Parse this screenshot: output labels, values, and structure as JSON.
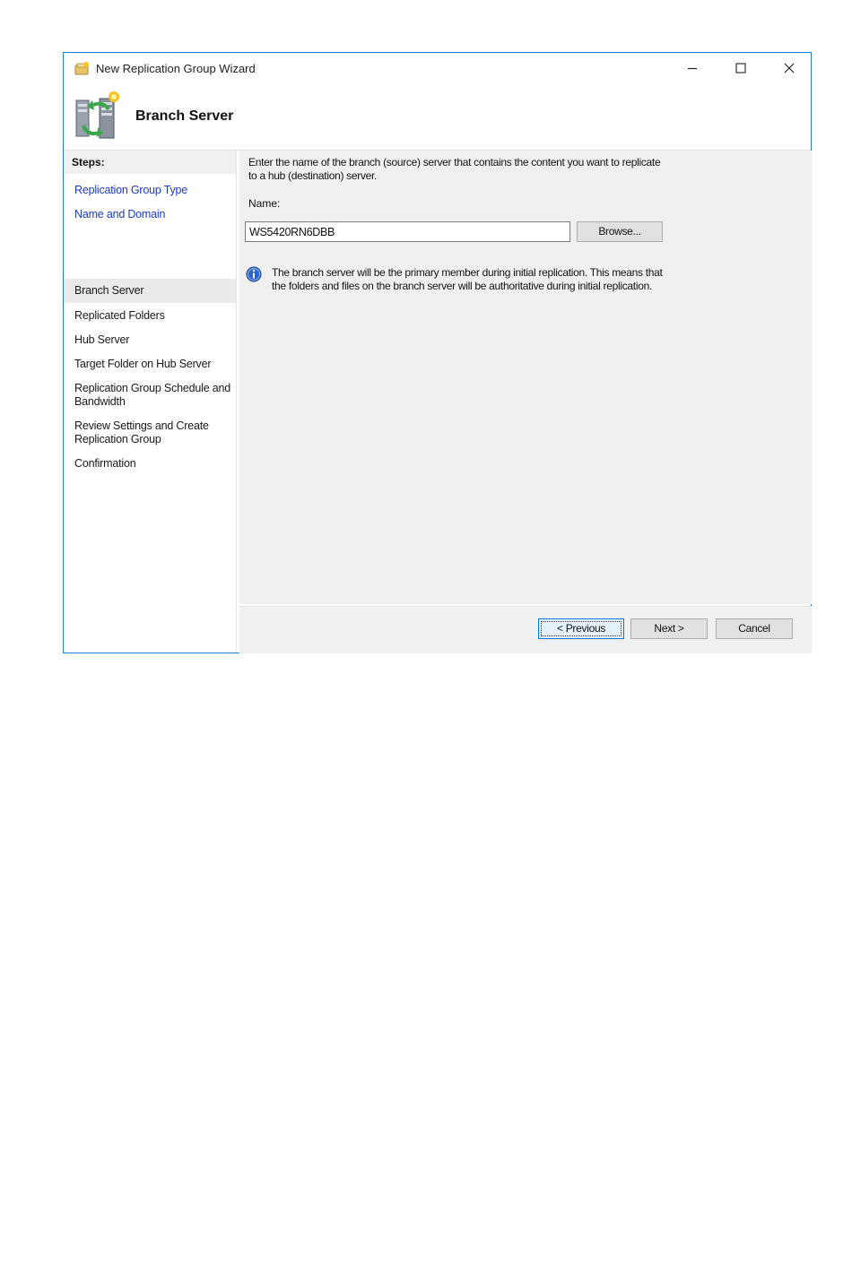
{
  "window": {
    "title": "New Replication Group Wizard",
    "controls": {
      "minimize_icon": "minimize-icon",
      "maximize_icon": "maximize-icon",
      "close_icon": "close-icon"
    }
  },
  "header": {
    "title": "Branch Server",
    "icon": "replication-server-icon"
  },
  "steps": {
    "heading": "Steps:",
    "items": [
      {
        "label": "Replication Group Type",
        "state": "link"
      },
      {
        "label": "Name and Domain",
        "state": "link"
      },
      {
        "label": "Branch Server",
        "state": "current"
      },
      {
        "label": "Replicated Folders",
        "state": "pending"
      },
      {
        "label": "Hub Server",
        "state": "pending"
      },
      {
        "label": "Target Folder on Hub Server",
        "state": "pending"
      },
      {
        "label": "Replication Group Schedule and Bandwidth",
        "state": "pending"
      },
      {
        "label": "Review Settings and Create Replication Group",
        "state": "pending"
      },
      {
        "label": "Confirmation",
        "state": "pending"
      }
    ]
  },
  "content": {
    "instructions": "Enter the name of the branch (source) server that contains the content you want to replicate to a hub (destination) server.",
    "name_label": "Name:",
    "name_value": "WS5420RN6DBB",
    "browse_label": "Browse...",
    "info_icon": "info-icon",
    "info_text": "The branch server will be the primary member during initial replication. This means that the folders and files on the branch server will be authoritative during initial replication."
  },
  "footer": {
    "previous_label": "< Previous",
    "next_label": "Next >",
    "cancel_label": "Cancel"
  },
  "colors": {
    "window_border": "#1e7fd6",
    "link": "#1a3cc8",
    "panel_bg": "#f0f0f0",
    "focus_border": "#0078d7"
  }
}
